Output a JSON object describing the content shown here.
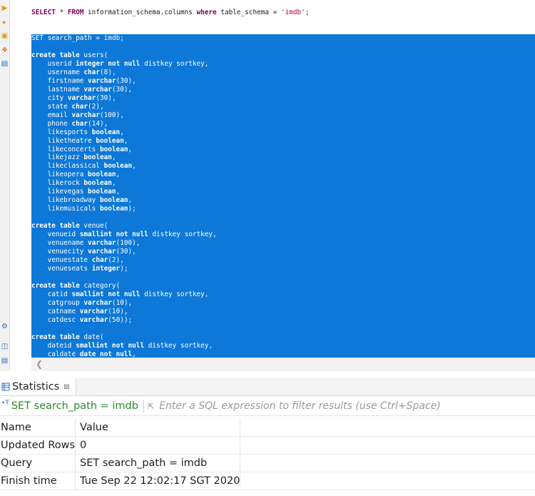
{
  "editor": {
    "first_query": {
      "kw_select": "SELECT",
      "text1": " * ",
      "kw_from": "FROM",
      "text2": " information_schema.columns ",
      "kw_where": "where",
      "text3": " table_schema = ",
      "literal": "'imdb'",
      "text4": ";"
    },
    "selected_lines": [
      "SET search_path = imdb;",
      "",
      "create table users(",
      "    userid integer not null distkey sortkey,",
      "    username char(8),",
      "    firstname varchar(30),",
      "    lastname varchar(30),",
      "    city varchar(30),",
      "    state char(2),",
      "    email varchar(100),",
      "    phone char(14),",
      "    likesports boolean,",
      "    liketheatre boolean,",
      "    likeconcerts boolean,",
      "    likejazz boolean,",
      "    likeclassical boolean,",
      "    likeopera boolean,",
      "    likerock boolean,",
      "    likevegas boolean,",
      "    likebroadway boolean,",
      "    likemusicals boolean);",
      "",
      "create table venue(",
      "    venueid smallint not null distkey sortkey,",
      "    venuename varchar(100),",
      "    venuecity varchar(30),",
      "    venuestate char(2),",
      "    venueseats integer);",
      "",
      "create table category(",
      "    catid smallint not null distkey sortkey,",
      "    catgroup varchar(10),",
      "    catname varchar(10),",
      "    catdesc varchar(50));",
      "",
      "create table date(",
      "    dateid smallint not null distkey sortkey,",
      "    caldate date not null,"
    ]
  },
  "toolbar": {
    "icons": [
      "execute-statement-icon",
      "execute-script-icon",
      "explain-plan-icon",
      "load-plan-icon",
      "format-sql-icon",
      "settings-icon",
      "export-icon",
      "output-icon"
    ]
  },
  "results": {
    "tab_label": "Statistics",
    "tab_close": "⊠",
    "query_label": "SET search_path = imdb",
    "filter_placeholder": "Enter a SQL expression to filter results (use Ctrl+Space)",
    "headers": [
      "Name",
      "Value"
    ],
    "rows": [
      {
        "name": "Updated Rows",
        "value": "0"
      },
      {
        "name": "Query",
        "value": "SET search_path = imdb"
      },
      {
        "name": "Finish time",
        "value": "Tue Sep 22 12:02:17 SGT 2020"
      }
    ]
  },
  "colors": {
    "selection": "#0d78d8",
    "keyword": "#7f0055",
    "string": "#b3003b",
    "query_text": "#2c8a2c"
  }
}
